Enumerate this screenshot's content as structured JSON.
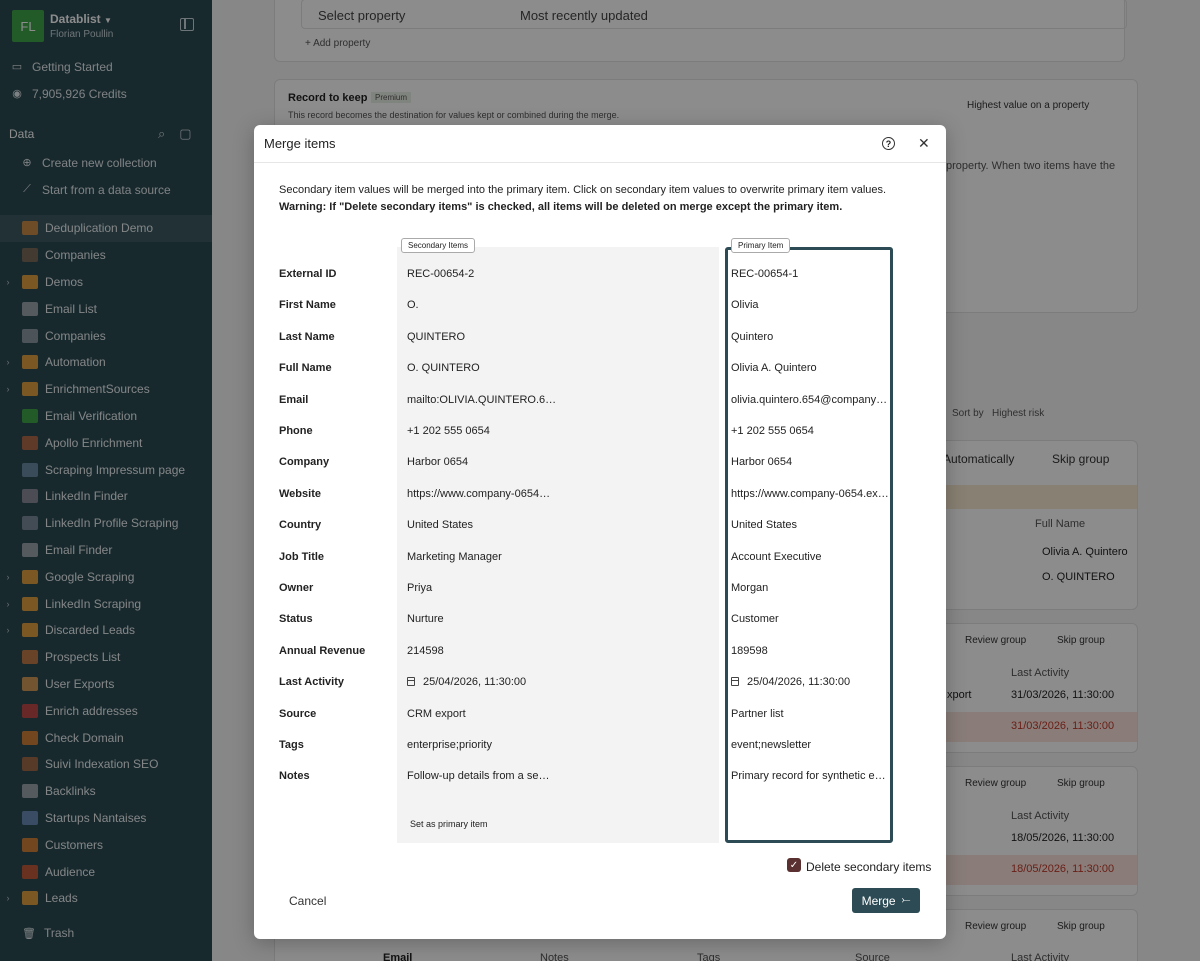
{
  "sidebar": {
    "workspace_initials": "FL",
    "workspace_name": "Datablist",
    "user_name": "Florian Poullin",
    "getting_started": "Getting Started",
    "credits": "7,905,926 Credits",
    "data_section": "Data",
    "create_collection": "Create new collection",
    "start_from_source": "Start from a data source",
    "collections": [
      {
        "label": "Deduplication Demo",
        "color": "#c88a4a",
        "folder": false
      },
      {
        "label": "Companies",
        "color": "#7a6a5a",
        "folder": false
      },
      {
        "label": "Demos",
        "color": "#e0a040",
        "folder": true
      },
      {
        "label": "Email List",
        "color": "#9aa4ab",
        "folder": false
      },
      {
        "label": "Companies",
        "color": "#8a9aa4",
        "folder": false
      },
      {
        "label": "Automation",
        "color": "#e0a040",
        "folder": true
      },
      {
        "label": "EnrichmentSources",
        "color": "#e0a040",
        "folder": true
      },
      {
        "label": "Email Verification",
        "color": "#3ea64a",
        "folder": false
      },
      {
        "label": "Apollo Enrichment",
        "color": "#b06a4a",
        "folder": false
      },
      {
        "label": "Scraping Impressum page",
        "color": "#6a8aa4",
        "folder": false
      },
      {
        "label": "LinkedIn Finder",
        "color": "#8a8a9a",
        "folder": false
      },
      {
        "label": "LinkedIn Profile Scraping",
        "color": "#7a8a9a",
        "folder": false
      },
      {
        "label": "Email Finder",
        "color": "#9aa4ab",
        "folder": false
      },
      {
        "label": "Google Scraping",
        "color": "#e0a040",
        "folder": true
      },
      {
        "label": "LinkedIn Scraping",
        "color": "#e0a040",
        "folder": true
      },
      {
        "label": "Discarded Leads",
        "color": "#e0a040",
        "folder": true
      },
      {
        "label": "Prospects List",
        "color": "#c07a4a",
        "folder": false
      },
      {
        "label": "User Exports",
        "color": "#d09a5a",
        "folder": false
      },
      {
        "label": "Enrich addresses",
        "color": "#c04a4a",
        "folder": false
      },
      {
        "label": "Check Domain",
        "color": "#d0803a",
        "folder": false
      },
      {
        "label": "Suivi Indexation SEO",
        "color": "#a06a4a",
        "folder": false
      },
      {
        "label": "Backlinks",
        "color": "#9aa4ab",
        "folder": false
      },
      {
        "label": "Startups Nantaises",
        "color": "#6a8ab4",
        "folder": false
      },
      {
        "label": "Customers",
        "color": "#d0803a",
        "folder": false
      },
      {
        "label": "Audience",
        "color": "#c05a3a",
        "folder": false
      },
      {
        "label": "Leads",
        "color": "#e0a040",
        "folder": true
      }
    ],
    "trash": "Trash"
  },
  "background": {
    "select_property": "Select property",
    "most_recently_updated": "Most recently updated",
    "add_property": "+ Add property",
    "record_to_keep": "Record to keep",
    "premium": "Premium",
    "record_desc": "This record becomes the destination for values kept or combined during the merge.",
    "highest_value": "Highest value on a property",
    "property_text": "property. When two items have the",
    "sort_by": "Sort by",
    "highest_risk": "Highest risk",
    "automatically": "Automatically",
    "skip_group": "Skip group",
    "review_group": "Review group",
    "full_name_header": "Full Name",
    "name1": "Olivia A. Quintero",
    "name2": "O. QUINTERO",
    "last_activity_header": "Last Activity",
    "export_text": "xport",
    "date_a1": "31/03/2026, 11:30:00",
    "date_a2": "31/03/2026, 11:30:00",
    "date_b1": "18/05/2026, 11:30:00",
    "date_b2": "18/05/2026, 11:30:00",
    "bottom_headers": [
      "Email",
      "Notes",
      "Tags",
      "Source",
      "Last Activity"
    ]
  },
  "modal": {
    "title": "Merge items",
    "description": "Secondary item values will be merged into the primary item. Click on secondary item values to overwrite primary item values.",
    "warning": "Warning: If \"Delete secondary items\" is checked, all items will be deleted on merge except the primary item.",
    "secondary_tag": "Secondary Items",
    "primary_tag": "Primary Item",
    "fields": [
      {
        "label": "External ID",
        "secondary": "REC-00654-2",
        "primary": "REC-00654-1"
      },
      {
        "label": "First Name",
        "secondary": "O.",
        "primary": "Olivia"
      },
      {
        "label": "Last Name",
        "secondary": "QUINTERO",
        "primary": "Quintero"
      },
      {
        "label": "Full Name",
        "secondary": "O. QUINTERO",
        "primary": "Olivia A. Quintero"
      },
      {
        "label": "Email",
        "secondary": "mailto:OLIVIA.QUINTERO.6…",
        "primary": "olivia.quintero.654@company-…"
      },
      {
        "label": "Phone",
        "secondary": "+1 202 555 0654",
        "primary": "+1 202 555 0654"
      },
      {
        "label": "Company",
        "secondary": "Harbor 0654",
        "primary": "Harbor 0654"
      },
      {
        "label": "Website",
        "secondary": "https://www.company-0654…",
        "primary": "https://www.company-0654.ex…"
      },
      {
        "label": "Country",
        "secondary": "United States",
        "primary": "United States"
      },
      {
        "label": "Job Title",
        "secondary": "Marketing Manager",
        "primary": "Account Executive"
      },
      {
        "label": "Owner",
        "secondary": "Priya",
        "primary": "Morgan"
      },
      {
        "label": "Status",
        "secondary": "Nurture",
        "primary": "Customer"
      },
      {
        "label": "Annual Revenue",
        "secondary": "214598",
        "primary": "189598"
      },
      {
        "label": "Last Activity",
        "secondary": "25/04/2026, 11:30:00",
        "primary": "25/04/2026, 11:30:00",
        "date": true
      },
      {
        "label": "Source",
        "secondary": "CRM export",
        "primary": "Partner list"
      },
      {
        "label": "Tags",
        "secondary": "enterprise;priority",
        "primary": "event;newsletter"
      },
      {
        "label": "Notes",
        "secondary": "Follow-up details from a se…",
        "primary": "Primary record for synthetic e…"
      }
    ],
    "set_primary": "Set as primary item",
    "delete_secondary": "Delete secondary items",
    "delete_secondary_checked": true,
    "cancel": "Cancel",
    "merge": "Merge"
  }
}
